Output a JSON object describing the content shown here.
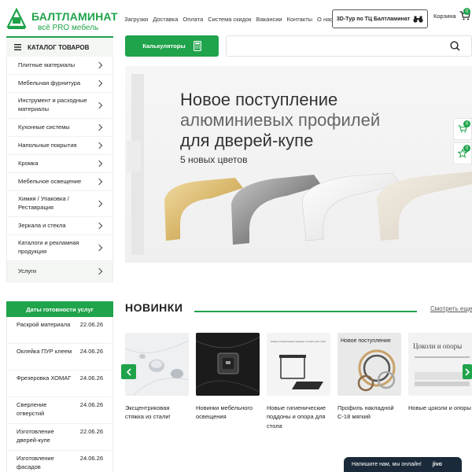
{
  "header": {
    "logo_title": "БАЛТЛАМИНАТ",
    "logo_slogan": "всё PRO мебель",
    "nav": [
      "Загрузки",
      "Доставка",
      "Оплата",
      "Система скидок",
      "Вакансии",
      "Контакты",
      "О нас"
    ],
    "tour_button": "3D-Тур по ТЦ Балтламинат",
    "cart_label": "Корзина",
    "cart_count": "0"
  },
  "catalog": {
    "title": "КАТАЛОГ ТОВАРОВ",
    "items": [
      "Плитные материалы",
      "Мебельная фурнитура",
      "Инструмент и расходные материалы",
      "Кухонные системы",
      "Напольные покрытия",
      "Кромка",
      "Мебельное освещение",
      "Химия / Упаковка / Реставрация",
      "Зеркала и стекла",
      "Каталоги и рекламная продукция",
      "Услуги"
    ]
  },
  "toolbar": {
    "calc_label": "Калькуляторы",
    "search_placeholder": ""
  },
  "banner": {
    "line1": "Новое поступление",
    "line2": "алюминиевых профилей",
    "line3": "для дверей-купе",
    "line4": "5 новых цветов"
  },
  "floating": {
    "cart_count": "0",
    "fav_count": "0"
  },
  "dates_widget": {
    "title": "Даты готовности услуг",
    "rows": [
      {
        "name": "Раскрой материала",
        "date": "22.06.26"
      },
      {
        "name": "Оклейка ПУР клеем",
        "date": "24.06.26"
      },
      {
        "name": "Фрезеровка ХОМАГ",
        "date": "24.06.26"
      },
      {
        "name": "Сверление отверстий",
        "date": "24.06.26"
      },
      {
        "name": "Изготовление дверей-купе",
        "date": "22.06.26"
      },
      {
        "name": "Изготовление фасадов",
        "date": "24.06.26"
      }
    ]
  },
  "new_products": {
    "title": "НОВИНКИ",
    "see_all": "Смотреть еще",
    "items": [
      {
        "name": "Эксцентриковая стяжка из стали!"
      },
      {
        "name": "Новинки мебельного освещения"
      },
      {
        "name": "Новые гигиенические поддоны и опора для стола"
      },
      {
        "name": "Профиль накладной С-18 мягкий"
      },
      {
        "name": "Новые цоколи и опоры"
      }
    ],
    "thumb_texts": {
      "p3_caption": "Новые гигиенические поддоны и опоры для стола",
      "p4_title": "Новое поступление",
      "p5_title": "Цоколи и опоры"
    }
  },
  "chat": {
    "text": "Напишите нам, мы онлайн!",
    "brand": "jivo"
  },
  "colors": {
    "brand_green": "#1fa34b",
    "chat_bg": "#1a2a3a"
  }
}
